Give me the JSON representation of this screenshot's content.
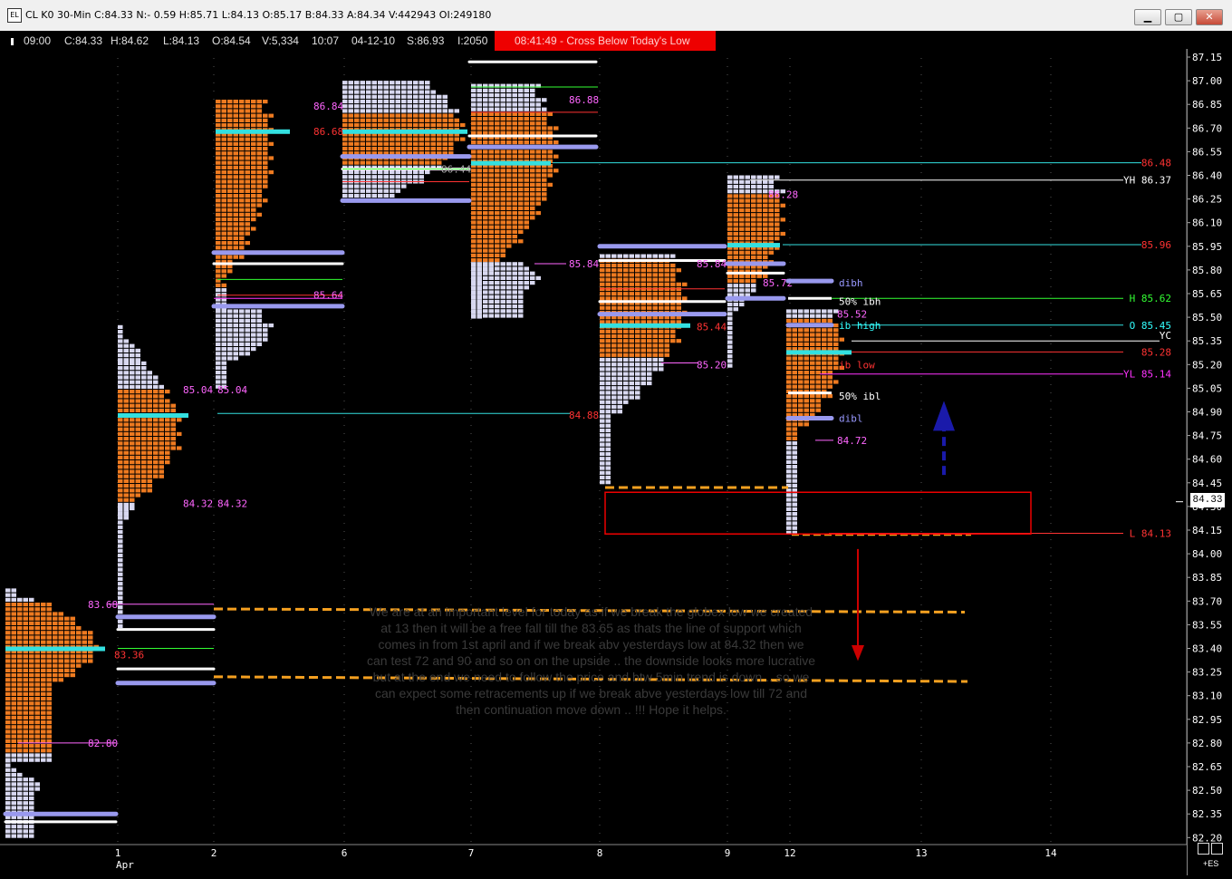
{
  "window": {
    "title": "CL K0 30-Min C:84.33 N:- 0.59 H:85.71 L:84.13 O:85.17 B:84.33 A:84.34 V:442943 OI:249180",
    "app_icon": "ts-app-icon",
    "buttons": {
      "minimize": "▁",
      "maximize": "▢",
      "close": "✕"
    }
  },
  "info_bar": {
    "time": "09:00",
    "close": "C:84.33",
    "high": "H:84.62",
    "low": "L:84.13",
    "open": "O:84.54",
    "volume": "V:5,334",
    "clock": "10:07",
    "date": "04-12-10",
    "s": "S:86.93",
    "i": "I:2050"
  },
  "alert": {
    "text": "08:41:49 - Cross Below Today's Low",
    "color": "#ee0000"
  },
  "price_axis": {
    "ticks": [
      "87.15",
      "87.00",
      "86.85",
      "86.70",
      "86.55",
      "86.40",
      "86.25",
      "86.10",
      "85.95",
      "85.80",
      "85.65",
      "85.50",
      "85.35",
      "85.20",
      "85.05",
      "84.90",
      "84.75",
      "84.60",
      "84.45",
      "84.30",
      "84.15",
      "84.00",
      "83.85",
      "83.70",
      "83.55",
      "83.40",
      "83.25",
      "83.10",
      "82.95",
      "82.80",
      "82.65",
      "82.50",
      "82.35",
      "82.20"
    ],
    "current_price": "84.33"
  },
  "date_axis": {
    "days": [
      "1",
      "2",
      "6",
      "7",
      "8",
      "9",
      "12",
      "13",
      "14"
    ],
    "month": "Apr"
  },
  "profile_labels": [
    {
      "text": "83.68",
      "color": "#ff66ff"
    },
    {
      "text": "82.80",
      "color": "#ff66ff"
    },
    {
      "text": "85.04",
      "color": "#ff66ff"
    },
    {
      "text": "85.04",
      "color": "#ff66ff"
    },
    {
      "text": "84.32",
      "color": "#ff66ff"
    },
    {
      "text": "84.32",
      "color": "#ff66ff"
    },
    {
      "text": "86.84",
      "color": "#ff66ff"
    },
    {
      "text": "86.68",
      "color": "#ff3333"
    },
    {
      "text": "85.64",
      "color": "#ff66ff"
    },
    {
      "text": "86.44",
      "color": "#aaaaaa"
    },
    {
      "text": "86.88",
      "color": "#ff66ff"
    },
    {
      "text": "85.84",
      "color": "#ff66ff"
    },
    {
      "text": "84.88",
      "color": "#ff3333"
    },
    {
      "text": "85.84",
      "color": "#ff66ff"
    },
    {
      "text": "85.44",
      "color": "#ff3333"
    },
    {
      "text": "85.20",
      "color": "#ff66ff"
    },
    {
      "text": "86.28",
      "color": "#ff66ff"
    },
    {
      "text": "85.72",
      "color": "#ff66ff"
    },
    {
      "text": "85.52",
      "color": "#ff66ff"
    },
    {
      "text": "84.72",
      "color": "#ff66ff"
    },
    {
      "text": "83.36",
      "color": "#ff3333"
    }
  ],
  "level_labels": [
    {
      "text": "86.48",
      "color": "#ff3333"
    },
    {
      "text": "YH  86.37",
      "color": "#ffffff"
    },
    {
      "text": "85.96",
      "color": "#ff3333"
    },
    {
      "text": "H  85.62",
      "color": "#33ff33"
    },
    {
      "text": "O  85.45",
      "color": "#33ffff"
    },
    {
      "text": "YC",
      "color": "#ffffff"
    },
    {
      "text": "85.28",
      "color": "#ff3333"
    },
    {
      "text": "YL  85.14",
      "color": "#ff33ff"
    },
    {
      "text": "L  84.13",
      "color": "#ff3333"
    }
  ],
  "reference_labels": [
    {
      "text": "dibh",
      "color": "#9999ff"
    },
    {
      "text": "50% ibh",
      "color": "#ffffff"
    },
    {
      "text": "ib high",
      "color": "#33ffff"
    },
    {
      "text": "ib low",
      "color": "#ff3333"
    },
    {
      "text": "50% ibl",
      "color": "#ffffff"
    },
    {
      "text": "dibl",
      "color": "#9999ff"
    }
  ],
  "annotation": {
    "comment": "We are at an important level for today as if we break the globex low we created at 13 then it will be a free fall till the 83.65 as thats the line of support which comes in from 1st april and if we break abv yesterdays low at 84.32 then we can test 72 and 90 and so on on the upside .. the downside looks more lucrative but at the end we need to follow the price and btw 5min trend is down .. so we can expect some retracements up if we break abve yesterdays low till 72 and then continuation move down .. !!! Hope it helps."
  },
  "symbol_tag": "+ES",
  "colors": {
    "tpo": "#ee7a20",
    "tpo_light": "#d8d8f0",
    "poc": "#33e0e0",
    "value_line": "#9999ee"
  }
}
